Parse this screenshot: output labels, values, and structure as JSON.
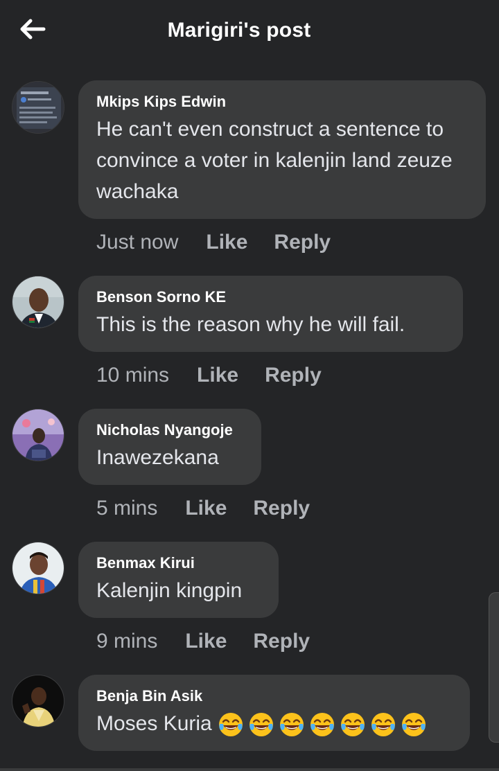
{
  "header": {
    "title": "Marigiri's post",
    "back_icon": "arrow-left-icon"
  },
  "comments": [
    {
      "author": "Mkips Kips Edwin",
      "text": "He can't even construct a sentence to convince a voter in kalenjin land zeuze wachaka",
      "time": "Just now",
      "like": "Like",
      "reply": "Reply"
    },
    {
      "author": "Benson Sorno KE",
      "text": "This is the reason why he will fail.",
      "time": "10 mins",
      "like": "Like",
      "reply": "Reply"
    },
    {
      "author": "Nicholas Nyangoje",
      "text": "Inawezekana",
      "time": "5 mins",
      "like": "Like",
      "reply": "Reply"
    },
    {
      "author": "Benmax Kirui",
      "text": "Kalenjin kingpin",
      "time": "9 mins",
      "like": "Like",
      "reply": "Reply"
    },
    {
      "author": "Benja Bin Asik",
      "text": "Moses Kuria",
      "emoji": "tears-of-joy-emoji",
      "emoji_count": 7
    }
  ],
  "colors": {
    "background": "#242527",
    "bubble": "#3a3b3c",
    "secondary_text": "#b0b3b8"
  }
}
